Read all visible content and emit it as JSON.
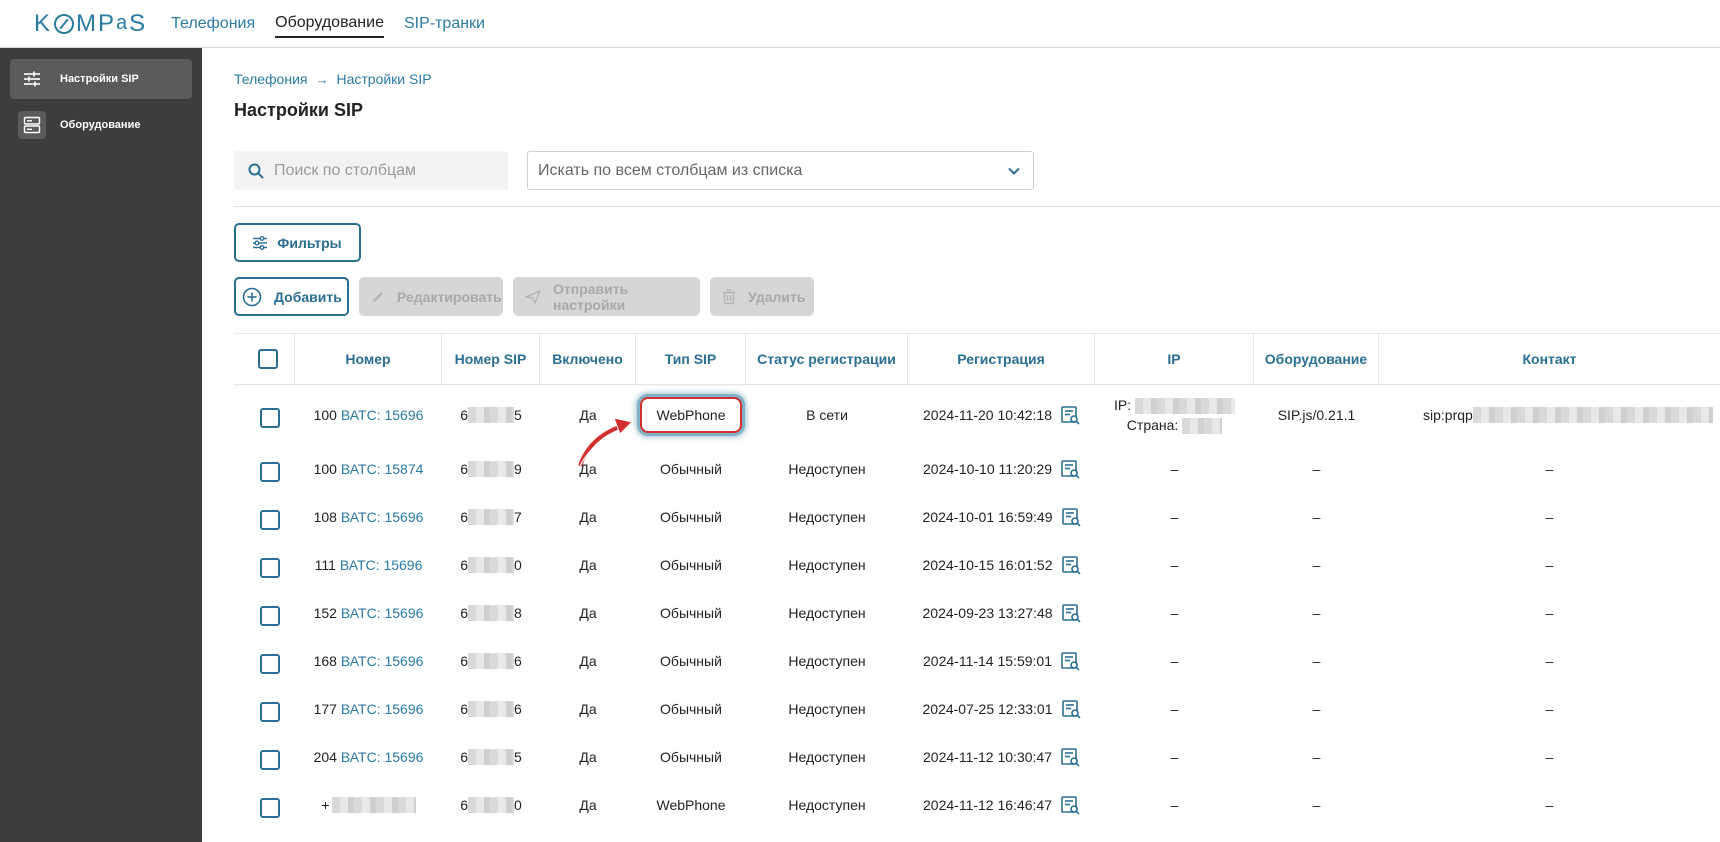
{
  "logo": "KOMPaS",
  "topnav": [
    {
      "label": "Телефония",
      "active": false
    },
    {
      "label": "Оборудование",
      "active": true
    },
    {
      "label": "SIP-транки",
      "active": false
    }
  ],
  "sidebar": {
    "items": [
      {
        "label": "Настройки SIP",
        "icon": "sliders-icon",
        "active": true
      },
      {
        "label": "Оборудование",
        "icon": "server-icon",
        "active": false
      }
    ]
  },
  "breadcrumb": {
    "parent": "Телефония",
    "separator": "→",
    "current": "Настройки SIP"
  },
  "page_title": "Настройки SIP",
  "search": {
    "placeholder": "Поиск по столбцам",
    "value": ""
  },
  "column_select": {
    "value": "Искать по всем столбцам из списка"
  },
  "buttons": {
    "filters": "Фильтры",
    "add": "Добавить",
    "edit": "Редактировать",
    "send": "Отправить настройки",
    "delete": "Удалить"
  },
  "table": {
    "headers": [
      "Номер",
      "Номер SIP",
      "Включено",
      "Тип SIP",
      "Статус регистрации",
      "Регистрация",
      "IP",
      "Оборудование",
      "Контакт"
    ],
    "rows": [
      {
        "num": "100",
        "ats": "ВАТС: 15696",
        "sip": [
          "6",
          "5"
        ],
        "enabled": "Да",
        "type": "WebPhone",
        "status": "В сети",
        "reg": "2024-11-20 10:42:18",
        "ip_label": "IP:",
        "country_label": "Страна:",
        "equipment": "SIP.js/0.21.1",
        "contact": "sip:prqp"
      },
      {
        "num": "100",
        "ats": "ВАТС: 15874",
        "sip": [
          "6",
          "9"
        ],
        "enabled": "Да",
        "type": "Обычный",
        "status": "Недоступен",
        "reg": "2024-10-10 11:20:29",
        "ip": "–",
        "equipment": "–",
        "contact": "–"
      },
      {
        "num": "108",
        "ats": "ВАТС: 15696",
        "sip": [
          "6",
          "7"
        ],
        "enabled": "Да",
        "type": "Обычный",
        "status": "Недоступен",
        "reg": "2024-10-01 16:59:49",
        "ip": "–",
        "equipment": "–",
        "contact": "–"
      },
      {
        "num": "111",
        "ats": "ВАТС: 15696",
        "sip": [
          "6",
          "0"
        ],
        "enabled": "Да",
        "type": "Обычный",
        "status": "Недоступен",
        "reg": "2024-10-15 16:01:52",
        "ip": "–",
        "equipment": "–",
        "contact": "–"
      },
      {
        "num": "152",
        "ats": "ВАТС: 15696",
        "sip": [
          "6",
          "8"
        ],
        "enabled": "Да",
        "type": "Обычный",
        "status": "Недоступен",
        "reg": "2024-09-23 13:27:48",
        "ip": "–",
        "equipment": "–",
        "contact": "–"
      },
      {
        "num": "168",
        "ats": "ВАТС: 15696",
        "sip": [
          "6",
          "6"
        ],
        "enabled": "Да",
        "type": "Обычный",
        "status": "Недоступен",
        "reg": "2024-11-14 15:59:01",
        "ip": "–",
        "equipment": "–",
        "contact": "–"
      },
      {
        "num": "177",
        "ats": "ВАТС: 15696",
        "sip": [
          "6",
          "6"
        ],
        "enabled": "Да",
        "type": "Обычный",
        "status": "Недоступен",
        "reg": "2024-07-25 12:33:01",
        "ip": "–",
        "equipment": "–",
        "contact": "–"
      },
      {
        "num": "204",
        "ats": "ВАТС: 15696",
        "sip": [
          "6",
          "5"
        ],
        "enabled": "Да",
        "type": "Обычный",
        "status": "Недоступен",
        "reg": "2024-11-12 10:30:47",
        "ip": "–",
        "equipment": "–",
        "contact": "–"
      },
      {
        "num": "+",
        "ats": "",
        "sip": [
          "6",
          "0"
        ],
        "enabled": "Да",
        "type": "WebPhone",
        "status": "Недоступен",
        "reg": "2024-11-12 16:46:47",
        "ip": "–",
        "equipment": "–",
        "contact": "–"
      }
    ]
  },
  "colors": {
    "accent": "#2a7ba4",
    "sidebar": "#3d3d3d",
    "highlight": "#d32f2f"
  }
}
